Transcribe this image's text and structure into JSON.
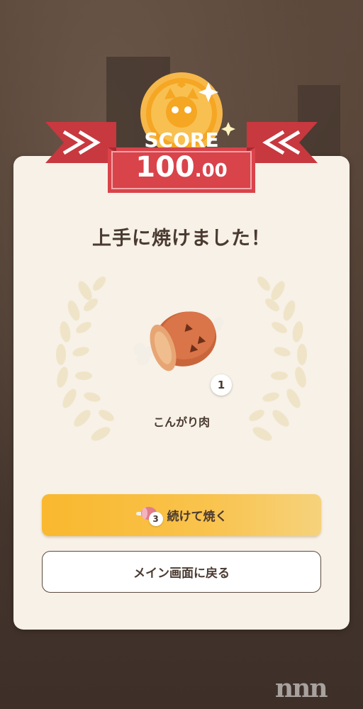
{
  "score": {
    "label": "SCORE",
    "integer": "100",
    "decimal": ".00"
  },
  "result": {
    "title": "上手に焼けました！"
  },
  "reward": {
    "icon": "meat-on-bone-icon",
    "count": "1",
    "name": "こんがり肉"
  },
  "buttons": {
    "continue": {
      "icon": "meat-icon",
      "badge": "3",
      "label": "続けて焼く"
    },
    "main": {
      "label": "メイン画面に戻る"
    }
  },
  "watermark": "nnn",
  "colors": {
    "ribbon": "#d9434a",
    "coin": "#f5a623",
    "button_primary": "#f9b82e",
    "card": "#f7f1e7",
    "text": "#4a3a30"
  }
}
